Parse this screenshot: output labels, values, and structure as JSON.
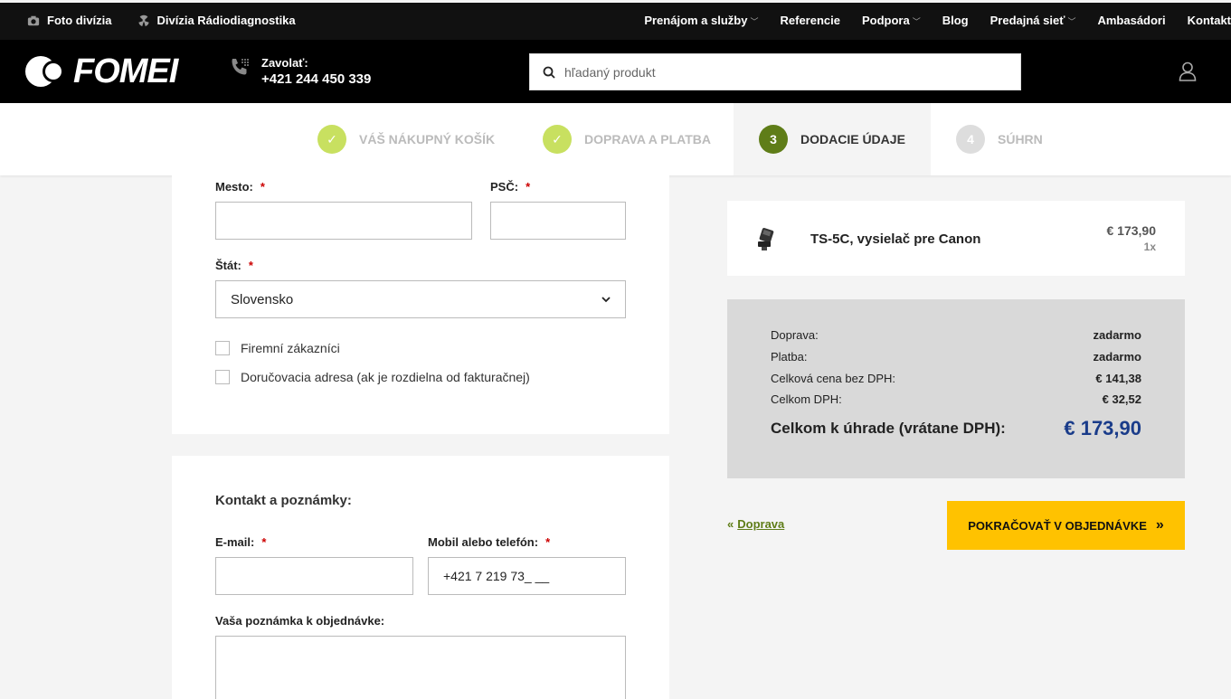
{
  "topbar": {
    "divisions": [
      {
        "label": "Foto divízia",
        "icon": "camera-icon"
      },
      {
        "label": "Divízia Rádiodiagnostika",
        "icon": "radiation-icon"
      }
    ],
    "menu": [
      {
        "label": "Prenájom a služby",
        "dropdown": true
      },
      {
        "label": "Referencie",
        "dropdown": false
      },
      {
        "label": "Podpora",
        "dropdown": true
      },
      {
        "label": "Blog",
        "dropdown": false
      },
      {
        "label": "Predajná sieť",
        "dropdown": true
      },
      {
        "label": "Ambasádori",
        "dropdown": false
      },
      {
        "label": "Kontakt",
        "dropdown": false
      }
    ]
  },
  "header": {
    "logo_text": "FOMEI",
    "phone_label": "Zavolať:",
    "phone_number": "+421 244 450 339",
    "search_placeholder": "hľadaný produkt"
  },
  "steps": [
    {
      "label": "Váš nákupný košík",
      "status": "done",
      "marker": "✓"
    },
    {
      "label": "Doprava a platba",
      "status": "done",
      "marker": "✓"
    },
    {
      "label": "Dodacie údaje",
      "status": "active",
      "marker": "3"
    },
    {
      "label": "Súhrn",
      "status": "todo",
      "marker": "4"
    }
  ],
  "form": {
    "city_label": "Mesto:",
    "zip_label": "PSČ:",
    "state_label": "Štát:",
    "required_mark": "*",
    "city_value": "",
    "zip_value": "",
    "state_value": "Slovensko",
    "checkbox_company": "Firemní zákazníci",
    "checkbox_delivery": "Doručovacia adresa (ak je rozdielna od fakturačnej)",
    "contact_title": "Kontakt a poznámky:",
    "email_label": "E-mail:",
    "email_value": "",
    "phone_label": "Mobil alebo telefón:",
    "phone_value": "+421 7 219 73_ __",
    "note_label": "Vaša poznámka k objednávke:",
    "note_value": ""
  },
  "product": {
    "name": "TS-5C, vysielač pre Canon",
    "price": "€ 173,90",
    "qty": "1x"
  },
  "summary": {
    "rows": [
      {
        "label": "Doprava:",
        "value": "zadarmo"
      },
      {
        "label": "Platba:",
        "value": "zadarmo"
      },
      {
        "label": "Celková cena bez DPH:",
        "value": "€ 141,38"
      },
      {
        "label": "Celkom DPH:",
        "value": "€ 32,52"
      }
    ],
    "total_label": "Celkom k úhrade (vrátane DPH):",
    "total_value": "€ 173,90"
  },
  "actions": {
    "back_arrow": "«",
    "back_label": "Doprava",
    "continue_label": "POKRAČOVAŤ V OBJEDNÁVKE",
    "continue_arrow": "»"
  },
  "colors": {
    "accent_green": "#5f7d18",
    "done_green": "#c8e060",
    "cta_yellow": "#ffc200",
    "total_blue": "#1a3c8a"
  }
}
